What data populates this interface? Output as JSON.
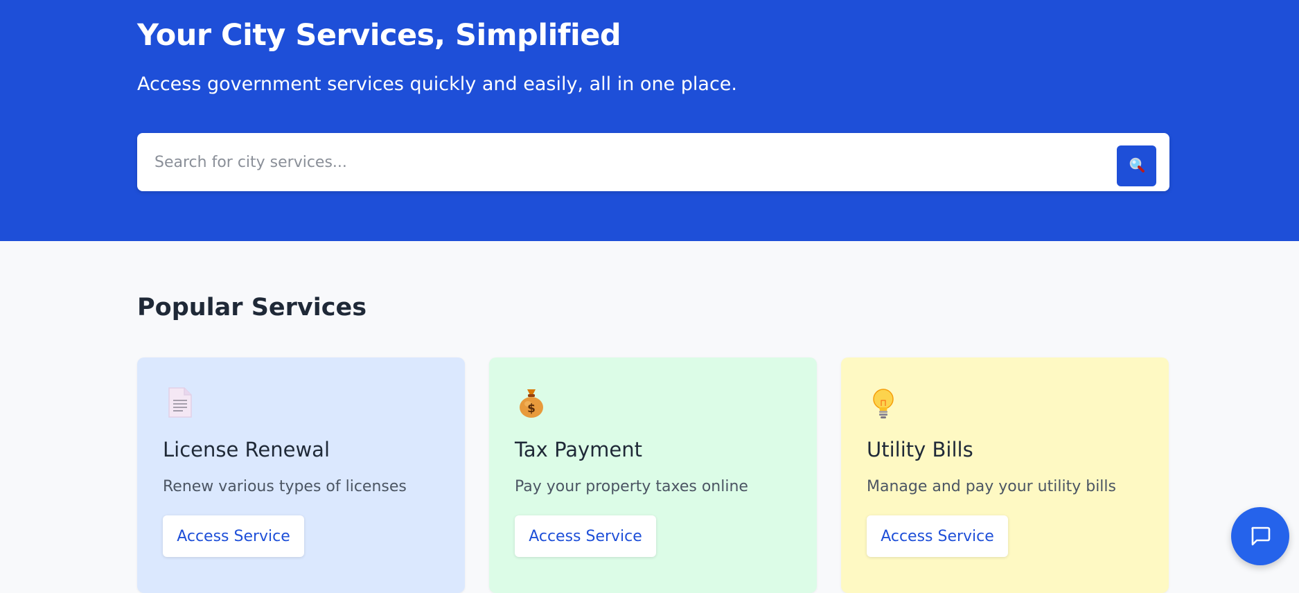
{
  "hero": {
    "title": "Your City Services, Simplified",
    "subtitle": "Access government services quickly and easily, all in one place.",
    "background": "#1e4fd8"
  },
  "search": {
    "placeholder": "Search for city services...",
    "value": "",
    "button_icon": "search-icon"
  },
  "popular": {
    "title": "Popular Services",
    "cards": [
      {
        "icon": "document-icon",
        "title": "License Renewal",
        "description": "Renew various types of licenses",
        "button_label": "Access Service",
        "background": "#dbe8fe"
      },
      {
        "icon": "money-bag-icon",
        "title": "Tax Payment",
        "description": "Pay your property taxes online",
        "button_label": "Access Service",
        "background": "#dcfce7"
      },
      {
        "icon": "light-bulb-icon",
        "title": "Utility Bills",
        "description": "Manage and pay your utility bills",
        "button_label": "Access Service",
        "background": "#fef9c3"
      }
    ]
  },
  "chat": {
    "icon": "chat-bubble-icon"
  },
  "colors": {
    "accent": "#1e4fd8",
    "page_background": "#f8f9fb",
    "heading_text": "#1f2937"
  }
}
